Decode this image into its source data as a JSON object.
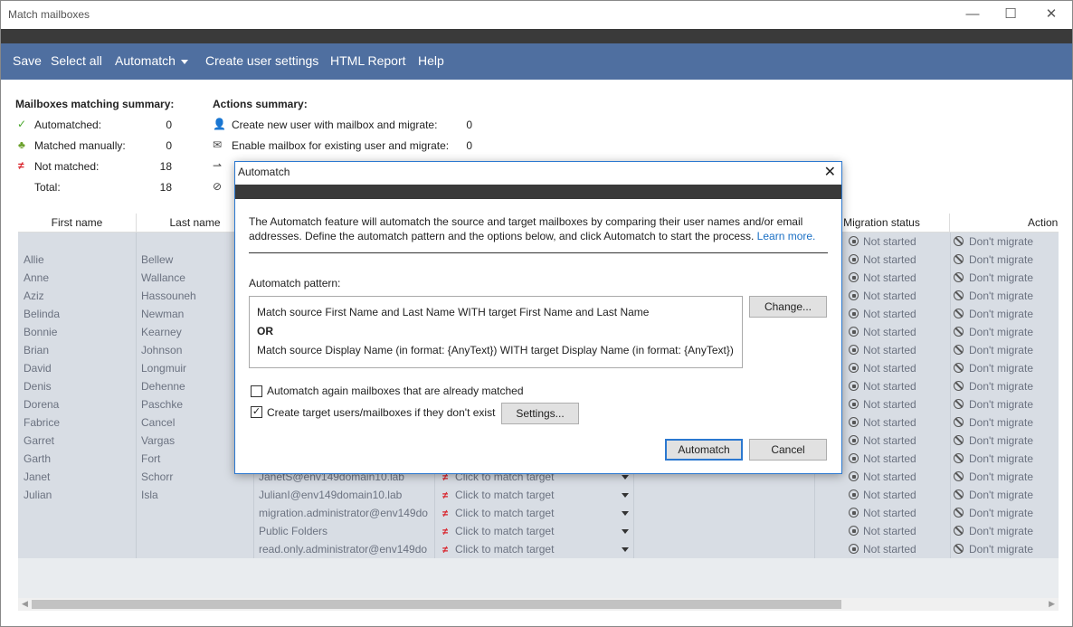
{
  "window": {
    "title": "Match mailboxes",
    "minimize": "—",
    "maximize": "☐",
    "close": "✕"
  },
  "menu": {
    "save": "Save",
    "select_all": "Select all",
    "automatch": "Automatch",
    "create_user_settings": "Create user settings",
    "html_report": "HTML Report",
    "help": "Help"
  },
  "summary": {
    "heading": "Mailboxes matching summary:",
    "automatched_label": "Automatched:",
    "automatched_value": "0",
    "manual_label": "Matched manually:",
    "manual_value": "0",
    "notmatched_label": "Not matched:",
    "notmatched_value": "18",
    "total_label": "Total:",
    "total_value": "18"
  },
  "actions": {
    "heading": "Actions summary:",
    "create_label": "Create new user with mailbox and migrate:",
    "create_value": "0",
    "enable_label": "Enable mailbox for existing user and migrate:",
    "enable_value": "0"
  },
  "table": {
    "headers": {
      "first": "First name",
      "last": "Last name",
      "migration": "Migration status",
      "action": "Action"
    },
    "rows": [
      {
        "first": "",
        "last": ""
      },
      {
        "first": "Allie",
        "last": "Bellew"
      },
      {
        "first": "Anne",
        "last": "Wallance"
      },
      {
        "first": "Aziz",
        "last": "Hassouneh"
      },
      {
        "first": "Belinda",
        "last": "Newman"
      },
      {
        "first": "Bonnie",
        "last": "Kearney"
      },
      {
        "first": "Brian",
        "last": "Johnson"
      },
      {
        "first": "David",
        "last": "Longmuir"
      },
      {
        "first": "Denis",
        "last": "Dehenne"
      },
      {
        "first": "Dorena",
        "last": "Paschke"
      },
      {
        "first": "Fabrice",
        "last": "Cancel"
      },
      {
        "first": "Garret",
        "last": "Vargas"
      },
      {
        "first": "Garth",
        "last": "Fort"
      },
      {
        "first": "Janet",
        "last": "Schorr",
        "source": "JanetS@env149domain10.lab",
        "target": "Click to match target"
      },
      {
        "first": "Julian",
        "last": "Isla",
        "source": "JulianI@env149domain10.lab",
        "target": "Click to match target"
      },
      {
        "first": "",
        "last": "",
        "source": "migration.administrator@env149do",
        "target": "Click to match target"
      },
      {
        "first": "",
        "last": "",
        "source": "Public Folders",
        "target": "Click to match target"
      },
      {
        "first": "",
        "last": "",
        "source": "read.only.administrator@env149do",
        "target": "Click to match target"
      }
    ],
    "status_text": "Not started",
    "action_text": "Don't migrate"
  },
  "dialog": {
    "title": "Automatch",
    "description_1": "The Automatch feature will automatch the source and target mailboxes by comparing their user names and/or email",
    "description_2": "addresses. Define the automatch pattern and the options below, and click Automatch to start the process.",
    "learn_more": "Learn more.",
    "pattern_label": "Automatch pattern:",
    "pattern_line1": "Match source First Name and Last Name WITH target First Name and Last Name",
    "pattern_or": "OR",
    "pattern_line2": "Match source Display Name (in format: {AnyText}) WITH target Display Name (in format: {AnyText})",
    "change_button": "Change...",
    "option_again": "Automatch again mailboxes that are already matched",
    "option_again_checked": false,
    "option_create": "Create target users/mailboxes if they don't exist",
    "option_create_checked": true,
    "settings_button": "Settings...",
    "automatch_button": "Automatch",
    "cancel_button": "Cancel"
  }
}
